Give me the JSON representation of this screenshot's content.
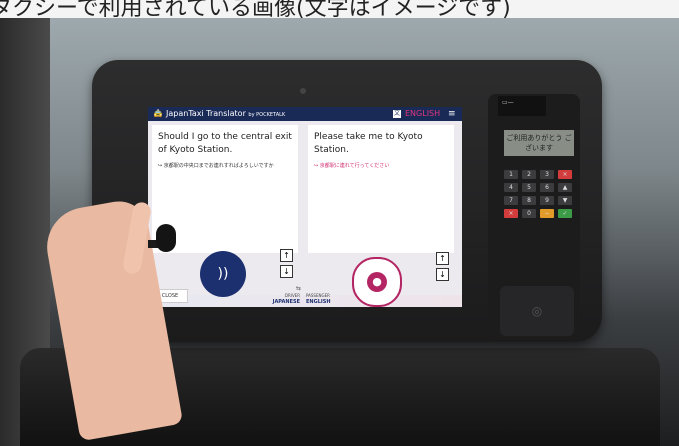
{
  "caption": "タクシーで利用されている画像(文字はイメージです)",
  "app": {
    "title": "JapanTaxi Translator",
    "by": "by POCKETALK",
    "language_button": "ENGLISH",
    "left_panel": {
      "main": "Should I go to the central exit of Kyoto Station.",
      "sub": "京都駅の中央口までお連れすればよろしいですか"
    },
    "right_panel": {
      "main": "Please take me to Kyoto Station.",
      "sub": "京都駅に連れて行ってください"
    },
    "close_label": "CLOSE",
    "driver_label": "DRIVER",
    "driver_lang": "JAPANESE",
    "passenger_label": "PASSENGER",
    "passenger_lang": "ENGLISH",
    "icons": {
      "taxi": "taxi-icon",
      "menu": "hamburger-menu-icon",
      "mic_left": "speaker-ear-icon",
      "mic_right": "microphone-icon",
      "scroll_up": "arrow-up-icon",
      "scroll_down": "arrow-down-icon"
    }
  },
  "terminal": {
    "lcd": "ご利用ありがとう ございます",
    "keys": [
      "1",
      "2",
      "3",
      "×",
      "4",
      "5",
      "6",
      "▲",
      "7",
      "8",
      "9",
      "▼",
      "×",
      "0",
      "−",
      "✓"
    ]
  },
  "colors": {
    "appbar": "#1a2a57",
    "accent_pink": "#d02c6d",
    "mic_navy": "#1c2f6f",
    "mic_magenta": "#b32663"
  }
}
